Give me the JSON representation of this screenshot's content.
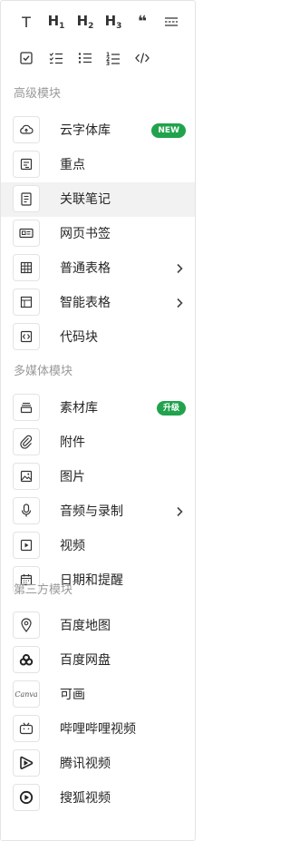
{
  "toolbar": {
    "row1": [
      {
        "name": "text-button",
        "glyph": "T"
      },
      {
        "name": "heading1-button",
        "glyph": "H",
        "sub": "1"
      },
      {
        "name": "heading2-button",
        "glyph": "H",
        "sub": "2"
      },
      {
        "name": "heading3-button",
        "glyph": "H",
        "sub": "3"
      },
      {
        "name": "quote-button",
        "glyph": "❝"
      },
      {
        "name": "divider-button",
        "icon": "divider-icon"
      }
    ],
    "row2": [
      {
        "name": "checkbox-button",
        "icon": "checkbox-icon"
      },
      {
        "name": "checklist-button",
        "icon": "checklist-icon"
      },
      {
        "name": "bullet-list-button",
        "icon": "bullet-list-icon"
      },
      {
        "name": "numbered-list-button",
        "icon": "numbered-list-icon"
      },
      {
        "name": "code-button",
        "icon": "code-icon"
      }
    ]
  },
  "sections": [
    {
      "title": "高级模块",
      "items": [
        {
          "label": "云字体库",
          "icon": "cloud-font-icon",
          "badge": "NEW"
        },
        {
          "label": "重点",
          "icon": "highlight-note-icon"
        },
        {
          "label": "关联笔记",
          "icon": "linked-note-icon",
          "active": true
        },
        {
          "label": "网页书签",
          "icon": "web-bookmark-icon"
        },
        {
          "label": "普通表格",
          "icon": "table-icon",
          "arrow": true
        },
        {
          "label": "智能表格",
          "icon": "smart-table-icon",
          "arrow": true
        },
        {
          "label": "代码块",
          "icon": "code-block-icon"
        }
      ]
    },
    {
      "title": "多媒体模块",
      "items": [
        {
          "label": "素材库",
          "icon": "material-library-icon",
          "badge": "升级"
        },
        {
          "label": "附件",
          "icon": "attachment-icon"
        },
        {
          "label": "图片",
          "icon": "image-icon"
        },
        {
          "label": "音频与录制",
          "icon": "microphone-icon",
          "arrow": true
        },
        {
          "label": "视频",
          "icon": "video-icon"
        },
        {
          "label": "日期和提醒",
          "icon": "calendar-icon"
        }
      ]
    },
    {
      "title": "第三方模块",
      "items": [
        {
          "label": "百度地图",
          "icon": "map-pin-icon"
        },
        {
          "label": "百度网盘",
          "icon": "baidu-cloud-icon"
        },
        {
          "label": "可画",
          "icon": "canva-icon",
          "logo_text": "Canva"
        },
        {
          "label": "哔哩哔哩视频",
          "icon": "bilibili-icon"
        },
        {
          "label": "腾讯视频",
          "icon": "tencent-video-icon"
        },
        {
          "label": "搜狐视频",
          "icon": "sohu-video-icon"
        }
      ]
    }
  ],
  "colors": {
    "badge": "#20a34c",
    "active_row": "#f2f2f2",
    "section_title": "#9a9a9a"
  }
}
